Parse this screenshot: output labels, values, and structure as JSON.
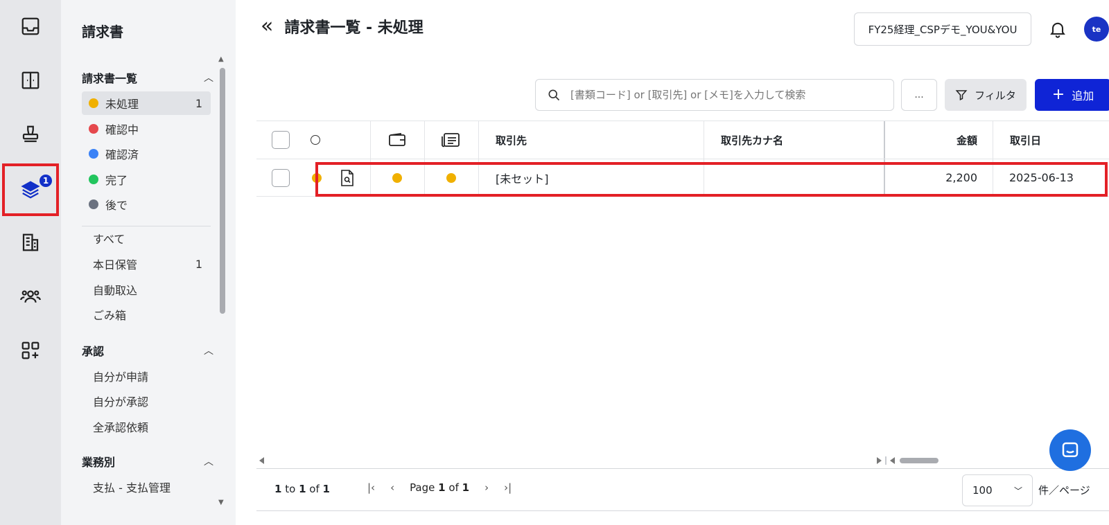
{
  "colors": {
    "accent": "#0f24d6",
    "highlight": "#e32026",
    "pending": "#f0b000",
    "checking": "#e5484d",
    "confirmed": "#3b82f6",
    "done": "#22c55e",
    "later": "#6b7280"
  },
  "rail": {
    "items": [
      {
        "icon": "inbox-icon"
      },
      {
        "icon": "layout-panel-icon"
      },
      {
        "icon": "stamp-icon"
      },
      {
        "icon": "layers-icon",
        "badge": "1",
        "active": true
      },
      {
        "icon": "building-icon"
      },
      {
        "icon": "users-icon"
      },
      {
        "icon": "add-widget-icon"
      }
    ]
  },
  "sidebar": {
    "title": "請求書",
    "sections": {
      "list": {
        "label": "請求書一覧"
      },
      "approval": {
        "label": "承認"
      },
      "business": {
        "label": "業務別"
      }
    },
    "status_items": [
      {
        "label": "未処理",
        "count": "1",
        "color": "#f0b000"
      },
      {
        "label": "確認中",
        "count": "",
        "color": "#e5484d"
      },
      {
        "label": "確認済",
        "count": "",
        "color": "#3b82f6"
      },
      {
        "label": "完了",
        "count": "",
        "color": "#22c55e"
      },
      {
        "label": "後で",
        "count": "",
        "color": "#6b7280"
      }
    ],
    "misc_items": [
      {
        "label": "すべて",
        "count": ""
      },
      {
        "label": "本日保管",
        "count": "1"
      },
      {
        "label": "自動取込",
        "count": ""
      },
      {
        "label": "ごみ箱",
        "count": ""
      }
    ],
    "approval_items": [
      {
        "label": "自分が申請"
      },
      {
        "label": "自分が承認"
      },
      {
        "label": "全承認依頼"
      }
    ],
    "business_items": [
      {
        "label": "支払 - 支払管理"
      }
    ]
  },
  "header": {
    "title": "請求書一覧 - 未処理",
    "company": "FY25経理_CSPデモ_YOU&YOU",
    "avatar": "te"
  },
  "toolbar": {
    "search_placeholder": "[書類コード] or [取引先] or [メモ]を入力して検索",
    "more_label": "...",
    "filter_label": "フィルタ",
    "add_label": "追加"
  },
  "table": {
    "headers": {
      "partner": "取引先",
      "partner_kana": "取引先カナ名",
      "amount": "金額",
      "date": "取引日"
    },
    "rows": [
      {
        "partner": "[未セット]",
        "partner_kana": "",
        "amount": "2,200",
        "date": "2025-06-13"
      }
    ]
  },
  "footer": {
    "range_from": "1",
    "range_to_word": "to",
    "range_to": "1",
    "range_of_word": "of",
    "range_total": "1",
    "page_word": "Page",
    "page_current": "1",
    "page_of_word": "of",
    "page_total": "1",
    "page_size": "100",
    "per_page_label": "件／ページ"
  }
}
